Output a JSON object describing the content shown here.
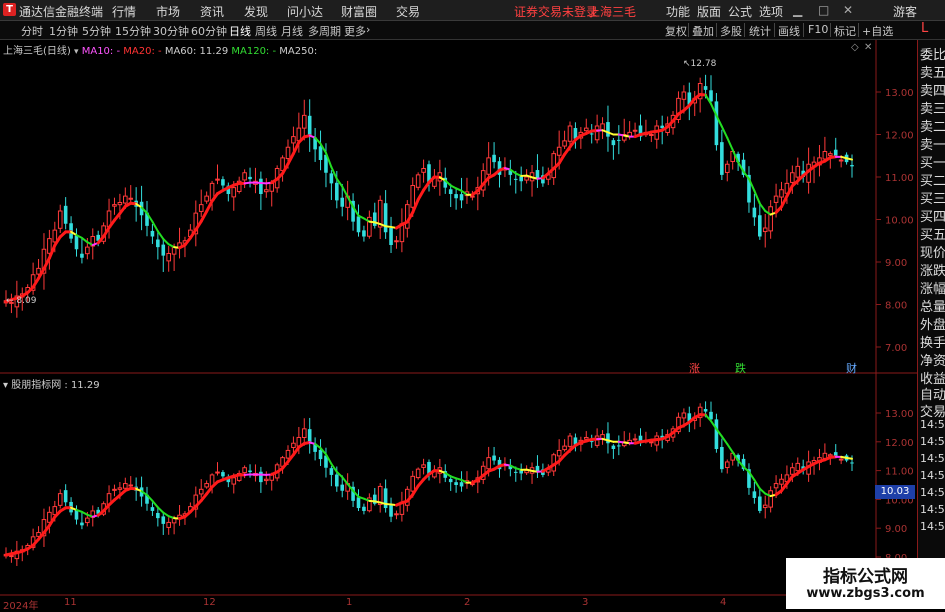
{
  "app": {
    "title": "通达信金融终端",
    "logo": "T"
  },
  "menu": [
    "行情",
    "市场",
    "资讯",
    "发现",
    "问小达",
    "财富圈",
    "交易"
  ],
  "notice": "证券交易未登录",
  "stock_name_top": "上海三毛",
  "top_right": [
    "功能",
    "版面",
    "公式",
    "选项"
  ],
  "guest": "游客",
  "periods": [
    "分时",
    "1分钟",
    "5分钟",
    "15分钟",
    "30分钟",
    "60分钟",
    "日线",
    "周线",
    "月线",
    "多周期",
    "更多"
  ],
  "active_period": "日线",
  "tools": [
    "复权",
    "叠加",
    "多股",
    "统计",
    "画线",
    "F10",
    "标记",
    "+自选"
  ],
  "side_button": "L",
  "main_legend": {
    "title": "上海三毛(日线)",
    "ma10": "MA10: -",
    "ma20": "MA20: -",
    "ma60": "MA60: 11.29",
    "ma120": "MA120: -",
    "ma250": "MA250:",
    "ma10_color": "#ff55ff",
    "ma20_color": "#ff3333",
    "ma60_color": "#cccccc",
    "ma120_color": "#33dd33",
    "ma250_color": "#cccccc"
  },
  "sub_legend": "股朋指标网 : 11.29",
  "main_y_ticks": [
    "13.00",
    "12.00",
    "11.00",
    "10.00",
    "9.00",
    "8.00",
    "7.00"
  ],
  "sub_y_ticks": [
    "13.00",
    "12.00",
    "11.00",
    "10.00",
    "9.00",
    "8.00"
  ],
  "price_high_label": "12.78",
  "price_low_label": "8.09",
  "cursor_value": "10.03",
  "markers": [
    {
      "text": "涨",
      "color": "#ff4444"
    },
    {
      "text": "跌",
      "color": "#33dd33"
    },
    {
      "text": "财",
      "color": "#66aaff"
    }
  ],
  "x_labels": [
    "2024年",
    "11",
    "12",
    "1",
    "2",
    "3",
    "4"
  ],
  "right_panel_top": [
    "委比",
    "卖五",
    "卖四",
    "卖三",
    "卖二",
    "卖一",
    "买一",
    "买二",
    "买三",
    "买四",
    "买五",
    "现价",
    "涨跌",
    "涨幅",
    "总量",
    "外盘",
    "换手",
    "净资",
    "收益"
  ],
  "right_panel_bottom": [
    "自动",
    "交易",
    "14:56",
    "14:56",
    "14:56",
    "14:56",
    "14:56",
    "14:56",
    "14:56"
  ],
  "watermark": {
    "line1": "指标公式网",
    "line2": "www.zbgs3.com"
  },
  "colors": {
    "up": "#ff3a3a",
    "down": "#33dddd",
    "line_up": "#ff1a1a",
    "line_flat": "#ffff33",
    "line_down": "#22dd22",
    "line_weak": "#ff33ff"
  },
  "chart_data": {
    "type": "candlestick",
    "closes": [
      8.09,
      8.05,
      8.2,
      8.25,
      8.4,
      8.7,
      8.85,
      9.3,
      9.55,
      9.75,
      10.2,
      9.9,
      9.55,
      9.3,
      9.1,
      9.35,
      9.6,
      9.5,
      9.85,
      10.2,
      10.35,
      10.4,
      10.55,
      10.5,
      10.3,
      10.1,
      9.85,
      9.6,
      9.35,
      9.15,
      9.2,
      9.35,
      9.45,
      9.5,
      9.75,
      10.15,
      10.35,
      10.55,
      10.85,
      10.95,
      10.8,
      10.6,
      10.75,
      10.9,
      11.1,
      10.95,
      10.9,
      10.6,
      10.7,
      10.85,
      11.2,
      11.45,
      11.7,
      11.95,
      12.15,
      12.45,
      11.95,
      11.65,
      11.4,
      11.1,
      10.85,
      10.45,
      10.3,
      10.55,
      9.95,
      9.7,
      9.6,
      10.05,
      9.85,
      10.45,
      9.7,
      9.4,
      9.5,
      9.9,
      10.35,
      10.8,
      11.05,
      11.2,
      10.85,
      11.0,
      11.1,
      10.75,
      10.6,
      10.5,
      10.45,
      10.65,
      10.55,
      10.75,
      11.15,
      11.45,
      11.35,
      11.05,
      11.2,
      11.05,
      10.95,
      10.9,
      11.0,
      11.1,
      10.95,
      10.85,
      11.05,
      11.55,
      11.7,
      11.85,
      12.2,
      11.9,
      12.05,
      12.15,
      12.0,
      12.2,
      12.25,
      11.95,
      11.75,
      11.85,
      12.0,
      12.05,
      12.1,
      11.95,
      12.05,
      12.0,
      12.2,
      12.15,
      12.25,
      12.45,
      12.85,
      13.0,
      12.7,
      12.85,
      13.2,
      13.05,
      12.78,
      11.75,
      11.05,
      11.3,
      11.6,
      11.35,
      11.05,
      10.4,
      10.05,
      9.6,
      9.8,
      10.3,
      10.55,
      10.7,
      10.85,
      11.1,
      11.25,
      11.0,
      11.3,
      11.35,
      11.45,
      11.6,
      11.55,
      11.5,
      11.4,
      11.35,
      11.25
    ]
  }
}
